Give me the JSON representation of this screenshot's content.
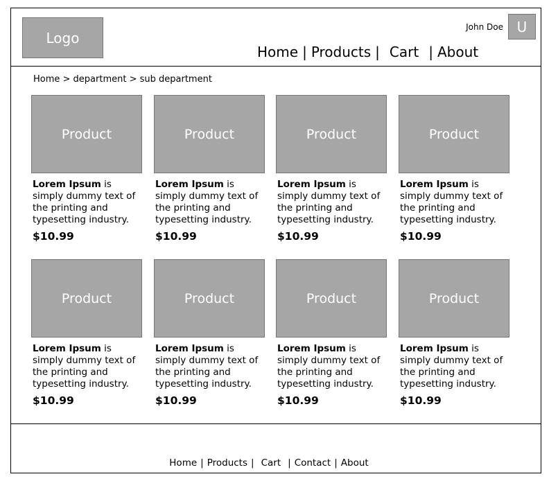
{
  "header": {
    "logo": "Logo",
    "user_name": "John Doe",
    "avatar_initial": "U",
    "nav": [
      "Home",
      "Products",
      "Cart",
      "About"
    ]
  },
  "breadcrumb": "Home > department > sub department",
  "products": [
    {
      "image_label": "Product",
      "name": "Lorem Ipsum",
      "desc": " is simply dummy text of the printing and typesetting industry.",
      "price": "$10.99"
    },
    {
      "image_label": "Product",
      "name": "Lorem Ipsum",
      "desc": " is simply dummy text of the printing and typesetting industry.",
      "price": "$10.99"
    },
    {
      "image_label": "Product",
      "name": "Lorem Ipsum",
      "desc": " is simply dummy text of the printing and typesetting industry.",
      "price": "$10.99"
    },
    {
      "image_label": "Product",
      "name": "Lorem Ipsum",
      "desc": " is simply dummy text of the printing and typesetting industry.",
      "price": "$10.99"
    },
    {
      "image_label": "Product",
      "name": "Lorem Ipsum",
      "desc": " is simply dummy text of the printing and typesetting industry.",
      "price": "$10.99"
    },
    {
      "image_label": "Product",
      "name": "Lorem Ipsum",
      "desc": " is simply dummy text of the printing and typesetting industry.",
      "price": "$10.99"
    },
    {
      "image_label": "Product",
      "name": "Lorem Ipsum",
      "desc": " is simply dummy text of the printing and typesetting industry.",
      "price": "$10.99"
    },
    {
      "image_label": "Product",
      "name": "Lorem Ipsum",
      "desc": " is simply dummy text of the printing and typesetting industry.",
      "price": "$10.99"
    }
  ],
  "footer": {
    "nav": [
      "Home",
      "Products",
      "Cart",
      "Contact",
      "About"
    ]
  }
}
